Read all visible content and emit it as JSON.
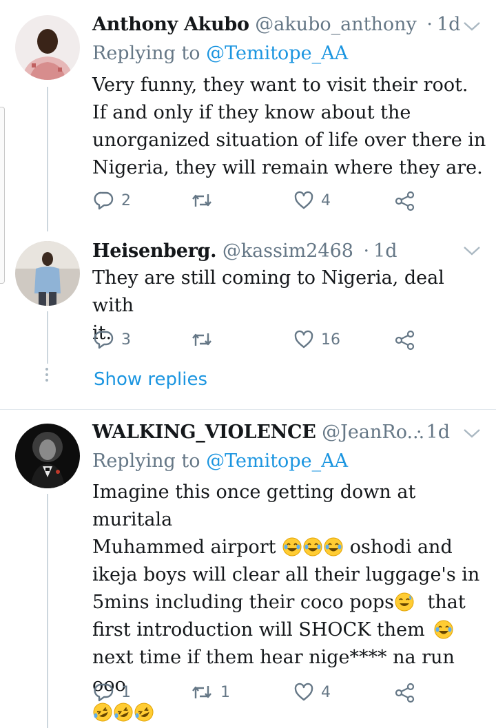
{
  "tweets": [
    {
      "name": "Anthony Akubo",
      "handle": "@akubo_anthony",
      "separator": "·",
      "time": "1d",
      "replying_prefix": "Replying to",
      "replying_to": "@Temitope_AA",
      "text_lines": [
        "Very funny, they want to visit their root.",
        "If and only if they know about the",
        "unorganized situation of life over there in",
        "Nigeria, they will remain where they are."
      ],
      "replies": "2",
      "retweets": "",
      "likes": "4"
    },
    {
      "name": "Heisenberg.",
      "handle": "@kassim2468",
      "separator": "·",
      "time": "1d",
      "text_lines": [
        "They are still coming to Nigeria, deal with",
        "it."
      ],
      "replies": "3",
      "retweets": "",
      "likes": "16",
      "show_replies": "Show replies"
    },
    {
      "name": "WALKING_VIOLENCE",
      "handle": "@JeanRo...",
      "separator": "·",
      "time": "1d",
      "replying_prefix": "Replying to",
      "replying_to": "@Temitope_AA",
      "text_parts": {
        "l1": "Imagine this once getting down at muritala",
        "l2a": "Muhammed airport",
        "l2b": "oshodi and",
        "l3": "ikeja boys will clear all their luggage's in",
        "l4a": "5mins including their coco pops",
        "l4b": "that",
        "l5a": "first introduction will SHOCK them",
        "l6": "next time if them hear nige**** na run ooo"
      },
      "replies": "1",
      "retweets": "1",
      "likes": "4"
    }
  ],
  "colors": {
    "accent": "#1b95e0",
    "muted": "#657786",
    "text": "#14171a",
    "divider": "#e1e8ed"
  },
  "icons": [
    "reply-icon",
    "retweet-icon",
    "like-icon",
    "share-icon",
    "chevron-down-icon",
    "tears-of-joy-emoji",
    "grinning-sweat-emoji",
    "rofl-emoji"
  ]
}
